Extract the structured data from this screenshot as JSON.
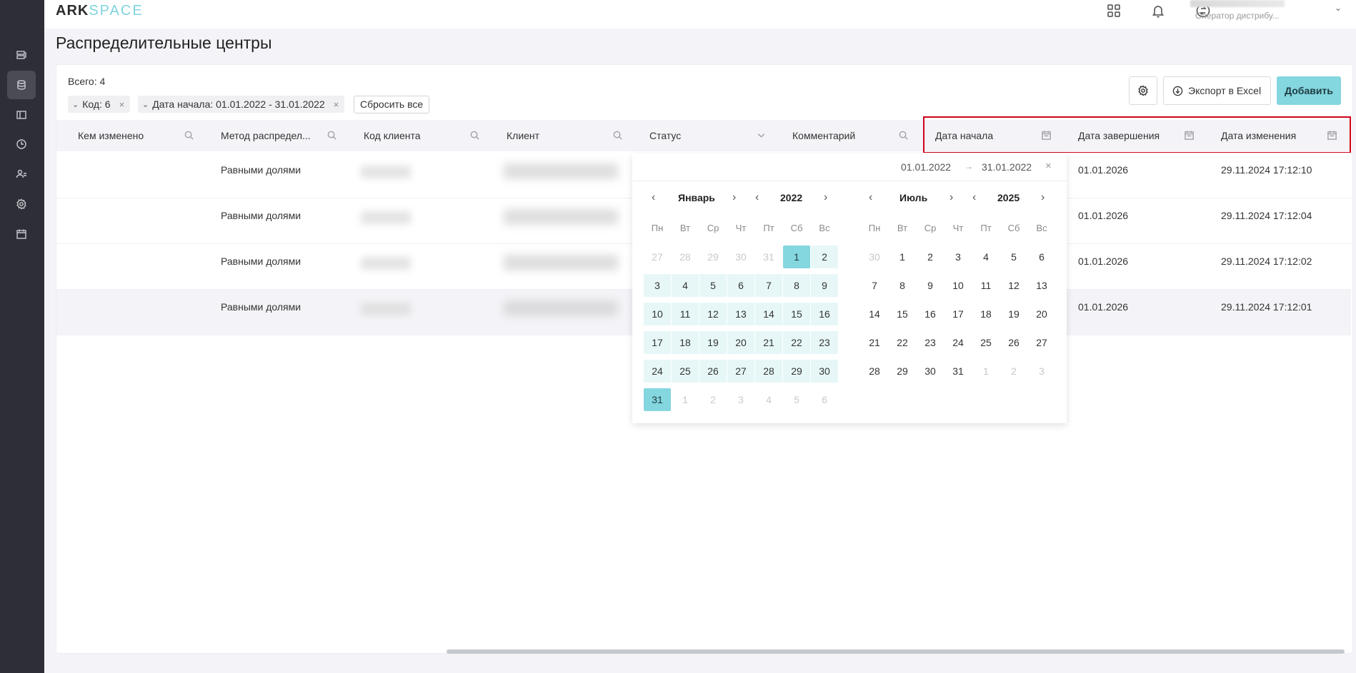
{
  "app": {
    "logo_part1": "ARK",
    "logo_part2": "SPACE",
    "user_role": "Оператор дистрибу...",
    "user_chevron": "⌄"
  },
  "sidebar": {
    "items": [
      {
        "icon": "list-icon",
        "active": false
      },
      {
        "icon": "database-icon",
        "active": true
      },
      {
        "icon": "layout-icon",
        "active": false
      },
      {
        "icon": "clock-icon",
        "active": false
      },
      {
        "icon": "users-icon",
        "active": false
      },
      {
        "icon": "settings-icon",
        "active": false
      },
      {
        "icon": "calendar-icon",
        "active": false
      }
    ]
  },
  "page": {
    "title": "Распределительные центры",
    "total": "Всего: 4"
  },
  "filters": {
    "chips": [
      {
        "label": "Код: 6",
        "chevron": "⌄",
        "remove": "×"
      },
      {
        "label": "Дата начала: 01.01.2022 - 31.01.2022",
        "chevron": "⌄",
        "remove": "×"
      }
    ],
    "reset_label": "Сбросить все"
  },
  "toolbar": {
    "export_label": "Экспорт в Excel",
    "add_label": "Добавить"
  },
  "table": {
    "columns": [
      {
        "label": "Кем изменено",
        "icon": "search-icon"
      },
      {
        "label": "Метод распредел...",
        "icon": "search-icon"
      },
      {
        "label": "Код клиента",
        "icon": "search-icon"
      },
      {
        "label": "Клиент",
        "icon": "search-icon"
      },
      {
        "label": "Статус",
        "icon": "chevron-down-icon"
      },
      {
        "label": "Комментарий",
        "icon": "search-icon"
      },
      {
        "label": "Дата начала",
        "icon": "calendar-icon"
      },
      {
        "label": "Дата завершения",
        "icon": "calendar-icon"
      },
      {
        "label": "Дата изменения",
        "icon": "calendar-icon"
      }
    ],
    "rows": [
      {
        "changed_by": "",
        "method": "Равными долями",
        "end_date": "01.01.2026",
        "modified": "29.11.2024 17:12:10"
      },
      {
        "changed_by": "",
        "method": "Равными долями",
        "end_date": "01.01.2026",
        "modified": "29.11.2024 17:12:04"
      },
      {
        "changed_by": "",
        "method": "Равными долями",
        "end_date": "01.01.2026",
        "modified": "29.11.2024 17:12:02"
      },
      {
        "changed_by": "",
        "method": "Равными долями",
        "end_date": "01.01.2026",
        "modified": "29.11.2024 17:12:01"
      }
    ]
  },
  "datepicker": {
    "start": "01.01.2022",
    "end": "31.01.2022",
    "arrow": "→",
    "close": "×",
    "nav": {
      "prev_month": "‹",
      "next_month": "›",
      "prev_year": "‹",
      "next_year": "›"
    },
    "weekdays": [
      "Пн",
      "Вт",
      "Ср",
      "Чт",
      "Пт",
      "Сб",
      "Вс"
    ],
    "left": {
      "month": "Январь",
      "year": "2022",
      "weeks": [
        [
          "27",
          "28",
          "29",
          "30",
          "31",
          "1",
          "2"
        ],
        [
          "3",
          "4",
          "5",
          "6",
          "7",
          "8",
          "9"
        ],
        [
          "10",
          "11",
          "12",
          "13",
          "14",
          "15",
          "16"
        ],
        [
          "17",
          "18",
          "19",
          "20",
          "21",
          "22",
          "23"
        ],
        [
          "24",
          "25",
          "26",
          "27",
          "28",
          "29",
          "30"
        ],
        [
          "31",
          "1",
          "2",
          "3",
          "4",
          "5",
          "6"
        ]
      ]
    },
    "right": {
      "month": "Июль",
      "year": "2025",
      "weeks": [
        [
          "30",
          "1",
          "2",
          "3",
          "4",
          "5",
          "6"
        ],
        [
          "7",
          "8",
          "9",
          "10",
          "11",
          "12",
          "13"
        ],
        [
          "14",
          "15",
          "16",
          "17",
          "18",
          "19",
          "20"
        ],
        [
          "21",
          "22",
          "23",
          "24",
          "25",
          "26",
          "27"
        ],
        [
          "28",
          "29",
          "30",
          "31",
          "1",
          "2",
          "3"
        ]
      ]
    }
  },
  "colors": {
    "accent": "#84d6df",
    "range": "#e7f7f8",
    "sidebar": "#2e2f36",
    "highlight": "#d0021b"
  }
}
